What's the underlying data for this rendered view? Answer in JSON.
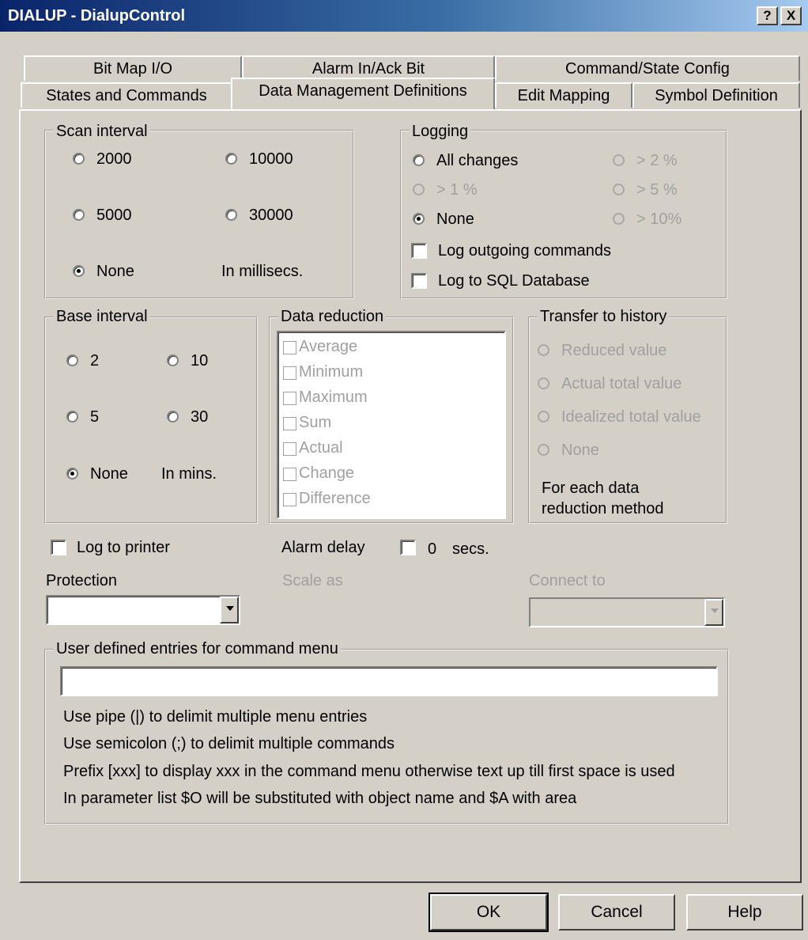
{
  "window": {
    "title": "DIALUP - DialupControl",
    "help_btn": "?",
    "close_btn": "X"
  },
  "tabs": {
    "row1": [
      "Bit Map I/O",
      "Alarm In/Ack Bit",
      "Command/State Config"
    ],
    "row2": [
      "States and Commands",
      "Data Management Definitions",
      "Edit Mapping",
      "Symbol Definition"
    ],
    "selected": "Data Management Definitions"
  },
  "scan_interval": {
    "legend": "Scan interval",
    "opt_2000": "2000",
    "opt_10000": "10000",
    "opt_5000": "5000",
    "opt_30000": "30000",
    "opt_none": "None",
    "unit": "In millisecs.",
    "selected": "None"
  },
  "logging": {
    "legend": "Logging",
    "all_changes": "All changes",
    "gt2": "> 2 %",
    "gt1": "> 1 %",
    "gt5": "> 5 %",
    "none": "None",
    "gt10": "> 10%",
    "selected": "None",
    "log_outgoing": "Log outgoing commands",
    "log_sql": "Log to SQL Database"
  },
  "base_interval": {
    "legend": "Base interval",
    "opt_2": "2",
    "opt_10": "10",
    "opt_5": "5",
    "opt_30": "30",
    "opt_none": "None",
    "unit": "In mins.",
    "selected": "None"
  },
  "data_reduction": {
    "legend": "Data reduction",
    "items": [
      "Average",
      "Minimum",
      "Maximum",
      "Sum",
      "Actual",
      "Change",
      "Difference"
    ]
  },
  "transfer_history": {
    "legend": "Transfer to history",
    "reduced": "Reduced value",
    "actual_total": "Actual total value",
    "idealized_total": "Idealized total value",
    "none": "None",
    "note_line1": "For each data",
    "note_line2": "reduction method"
  },
  "misc": {
    "log_printer": "Log to printer",
    "alarm_delay": "Alarm delay",
    "alarm_value": "0",
    "alarm_unit": "secs.",
    "protection": "Protection",
    "scale_as": "Scale as",
    "connect_to": "Connect to"
  },
  "user_entries": {
    "legend": "User defined entries for command menu",
    "value": "",
    "help": [
      "Use pipe (|) to delimit multiple menu entries",
      "Use semicolon (;) to delimit multiple commands",
      "Prefix [xxx] to display xxx in the command menu otherwise text up till first space is used",
      "In parameter list $O will be substituted with object name and $A with area"
    ]
  },
  "buttons": {
    "ok": "OK",
    "cancel": "Cancel",
    "help": "Help"
  }
}
